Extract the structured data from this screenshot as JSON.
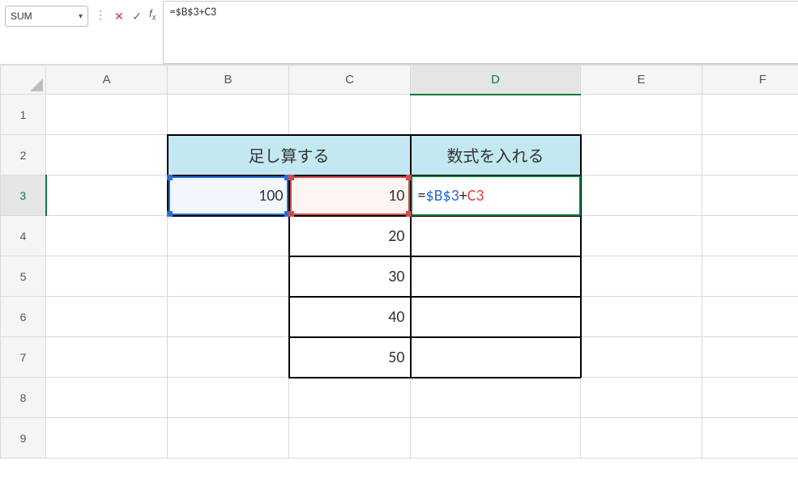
{
  "nameBox": {
    "value": "SUM"
  },
  "formulaBar": {
    "cancelGlyph": "✕",
    "enterGlyph": "✓",
    "fxLabel": "f",
    "fxSub": "x",
    "text": "=$B$3+C3"
  },
  "columns": [
    "A",
    "B",
    "C",
    "D",
    "E",
    "F"
  ],
  "rows": [
    "1",
    "2",
    "3",
    "4",
    "5",
    "6",
    "7",
    "8",
    "9"
  ],
  "activeCol": "D",
  "activeRow": "3",
  "headers": {
    "b2c2": "足し算する",
    "d2": "数式を入れる"
  },
  "cells": {
    "B3": "100",
    "C3": "10",
    "C4": "20",
    "C5": "30",
    "C6": "40",
    "C7": "50"
  },
  "formulaCell": {
    "eq": "=",
    "ref1": "$B$3",
    "plus": "+",
    "ref2": "C3"
  }
}
